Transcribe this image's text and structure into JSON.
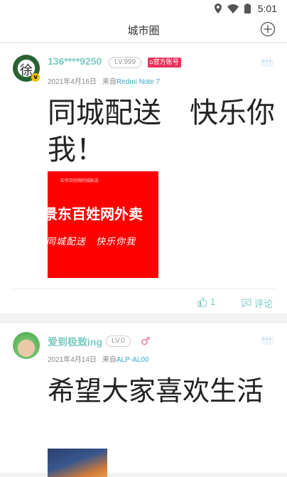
{
  "status_bar": {
    "time": "5:01",
    "icons": [
      "location-icon",
      "wifi-icon",
      "battery-icon"
    ]
  },
  "header": {
    "title": "城市圈",
    "add_icon": "plus-circle-icon"
  },
  "posts": [
    {
      "avatar_char": "徐",
      "avatar_badge": "v",
      "username": "136****9250",
      "level": "LV.999",
      "badge": "官方账号",
      "date": "2021年4月16日",
      "from_label": "来自",
      "device": "Redmi Note 7",
      "text": "同城配送　快乐你我！",
      "image": {
        "line1": "景东百姓网外卖",
        "line2": "同城配送　快乐你我",
        "small_text": "· 宏伟百姓网同城配送 ·"
      },
      "likes": "1",
      "comment_label": "评论"
    },
    {
      "username": "爱到极致ing",
      "level": "LV.0",
      "gender": "male",
      "gender_symbol": "♂",
      "date": "2021年4月14日",
      "from_label": "来自",
      "device": "ALP-AL00",
      "text": "希望大家喜欢生活"
    }
  ],
  "colors": {
    "accent": "#7ccac3",
    "device_link": "#3aa8c8",
    "official_badge": "#e8335a",
    "image_bg": "#ff0000"
  }
}
